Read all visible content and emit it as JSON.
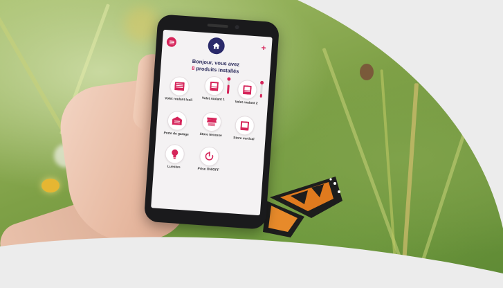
{
  "app": {
    "greeting_prefix": "Bonjour, vous avez",
    "product_count": "8",
    "greeting_suffix": "produits installés"
  },
  "header": {
    "menu_icon": "menu-icon",
    "home_icon": "home-icon",
    "add_symbol": "+"
  },
  "devices": [
    {
      "label": "Volet roulant Isoli",
      "icon": "roller-shutter-icon"
    },
    {
      "label": "Volet roulant 1",
      "icon": "shutter-icon"
    },
    {
      "label": "Volet roulant 2",
      "icon": "shutter-icon"
    },
    {
      "label": "Porte de garage",
      "icon": "garage-door-icon"
    },
    {
      "label": "Store terrasse",
      "icon": "awning-icon"
    },
    {
      "label": "Store vertical",
      "icon": "vertical-blind-icon"
    },
    {
      "label": "Lumière",
      "icon": "light-icon"
    },
    {
      "label": "Prise ON/OFF",
      "icon": "plug-icon"
    }
  ],
  "sliders": {
    "volet_1_level": 0.6,
    "volet_2_level": 0.25
  },
  "colors": {
    "accent": "#d6245a",
    "primary": "#2a2a6a",
    "background": "#ececec"
  }
}
